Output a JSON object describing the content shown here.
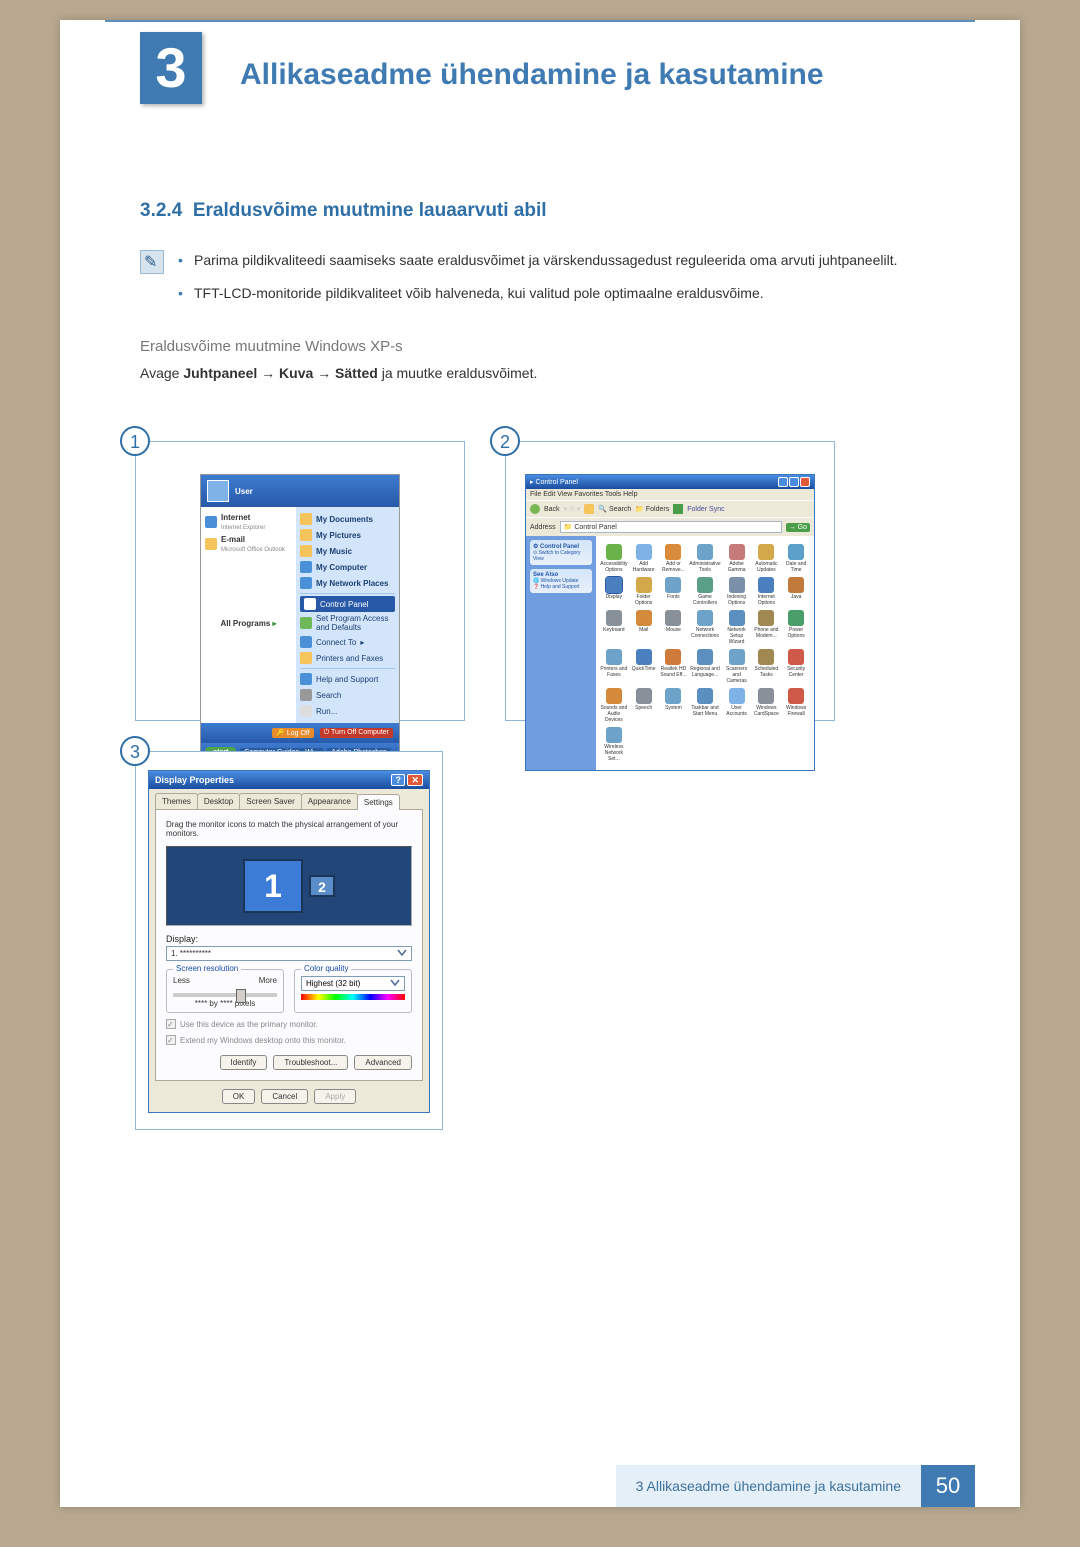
{
  "chapter": {
    "number": "3",
    "title": "Allikaseadme ühendamine ja kasutamine"
  },
  "section": {
    "number": "3.2.4",
    "title": "Eraldusvõime muutmine lauaarvuti abil"
  },
  "info_bullets": [
    "Parima pildikvaliteedi saamiseks saate eraldusvõimet ja värskendussagedust reguleerida oma arvuti juhtpaneelilt.",
    "TFT-LCD-monitoride pildikvaliteet võib halveneda, kui valitud pole optimaalne eraldusvõime."
  ],
  "subsection": "Eraldusvõime muutmine Windows XP-s",
  "nav": {
    "prefix": "Avage ",
    "step1": "Juhtpaneel",
    "arrow": " → ",
    "step2": "Kuva",
    "step3": "Sätted",
    "suffix": " ja muutke eraldusvõimet."
  },
  "figures": {
    "f1": "1",
    "f2": "2",
    "f3": "3"
  },
  "startmenu": {
    "user": "User",
    "left": {
      "internet": "Internet",
      "internet_sub": "Internet Explorer",
      "email": "E-mail",
      "email_sub": "Microsoft Office Outlook",
      "all_programs": "All Programs"
    },
    "right": {
      "my_documents": "My Documents",
      "my_pictures": "My Pictures",
      "my_music": "My Music",
      "my_computer": "My Computer",
      "my_network": "My Network Places",
      "control_panel": "Control Panel",
      "program_access": "Set Program Access and Defaults",
      "connect_to": "Connect To",
      "printers": "Printers and Faxes",
      "help": "Help and Support",
      "search": "Search",
      "run": "Run..."
    },
    "logoff": "Log Off",
    "turnoff": "Turn Off Computer",
    "start": "start",
    "task1": "Computer Guides - Wi...",
    "task2": "Adobe Photoshop"
  },
  "controlpanel": {
    "title": "Control Panel",
    "menu": "File    Edit    View    Favorites    Tools    Help",
    "back": "Back",
    "search": "Search",
    "folders": "Folders",
    "foldersync": "Folder Sync",
    "address_label": "Address",
    "address": "Control Panel",
    "side_cp": "Control Panel",
    "side_switch": "Switch to Category View",
    "side_seealso": "See Also",
    "side_wu": "Windows Update",
    "side_hs": "Help and Support",
    "icons": [
      "Accessibility Options",
      "Add Hardware",
      "Add or Remove...",
      "Administrative Tools",
      "Adobe Gamma",
      "Automatic Updates",
      "Date and Time",
      "Display",
      "Folder Options",
      "Fonts",
      "Game Controllers",
      "Indexing Options",
      "Internet Options",
      "Java",
      "Keyboard",
      "Mail",
      "Mouse",
      "Network Connections",
      "Network Setup Wizard",
      "Phone and Modem...",
      "Power Options",
      "Printers and Faxes",
      "QuickTime",
      "Realtek HD Sound Eff...",
      "Regional and Language...",
      "Scanners and Cameras",
      "Scheduled Tasks",
      "Security Center",
      "Sounds and Audio Devices",
      "Speech",
      "System",
      "Taskbar and Start Menu",
      "User Accounts",
      "Windows CardSpace",
      "Windows Firewall",
      "Wireless Network Set..."
    ]
  },
  "display_props": {
    "title": "Display Properties",
    "tabs": {
      "themes": "Themes",
      "desktop": "Desktop",
      "screensaver": "Screen Saver",
      "appearance": "Appearance",
      "settings": "Settings"
    },
    "hint": "Drag the monitor icons to match the physical arrangement of your monitors.",
    "mon1": "1",
    "mon2": "2",
    "display_label": "Display:",
    "display_value": "1. **********",
    "res_label": "Screen resolution",
    "res_less": "Less",
    "res_more": "More",
    "res_value": "**** by **** pixels",
    "cq_label": "Color quality",
    "cq_value": "Highest (32 bit)",
    "check1": "Use this device as the primary monitor.",
    "check2": "Extend my Windows desktop onto this monitor.",
    "identify": "Identify",
    "troubleshoot": "Troubleshoot...",
    "advanced": "Advanced",
    "ok": "OK",
    "cancel": "Cancel",
    "apply": "Apply"
  },
  "footer": {
    "text": "3 Allikaseadme ühendamine ja kasutamine",
    "page": "50"
  }
}
